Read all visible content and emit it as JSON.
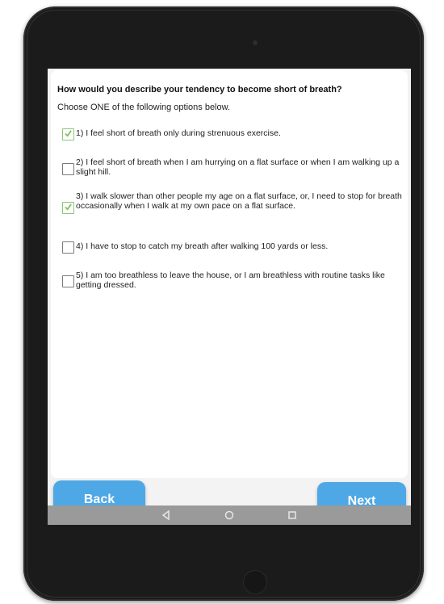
{
  "survey": {
    "question": "How would you describe your tendency to become short of breath?",
    "instruction": "Choose ONE of the following options below.",
    "options": [
      {
        "label": "1) I feel short of breath only during strenuous exercise.",
        "checked": true
      },
      {
        "label": "2) I feel short of breath when I am hurrying on a flat surface or when I am walking up a slight hill.",
        "checked": false
      },
      {
        "label": "3) I walk slower than other people my age on a flat surface, or, I need to stop for breath occasionally when I walk at my own pace on a flat surface.",
        "checked": true
      },
      {
        "label": "4) I have to stop to catch my breath after walking 100 yards or less.",
        "checked": false
      },
      {
        "label": "5) I am too breathless to leave the house, or I am breathless with routine tasks like getting dressed.",
        "checked": false
      }
    ]
  },
  "buttons": {
    "back": "Back",
    "next": "Next"
  },
  "navbar": {
    "icons": [
      "back-triangle-icon",
      "home-circle-icon",
      "recents-square-icon"
    ]
  },
  "colors": {
    "button": "#4ea8e5",
    "check": "#7cc35c",
    "navbar": "#9a9a9a",
    "screen_background": "#f3f3f3"
  }
}
